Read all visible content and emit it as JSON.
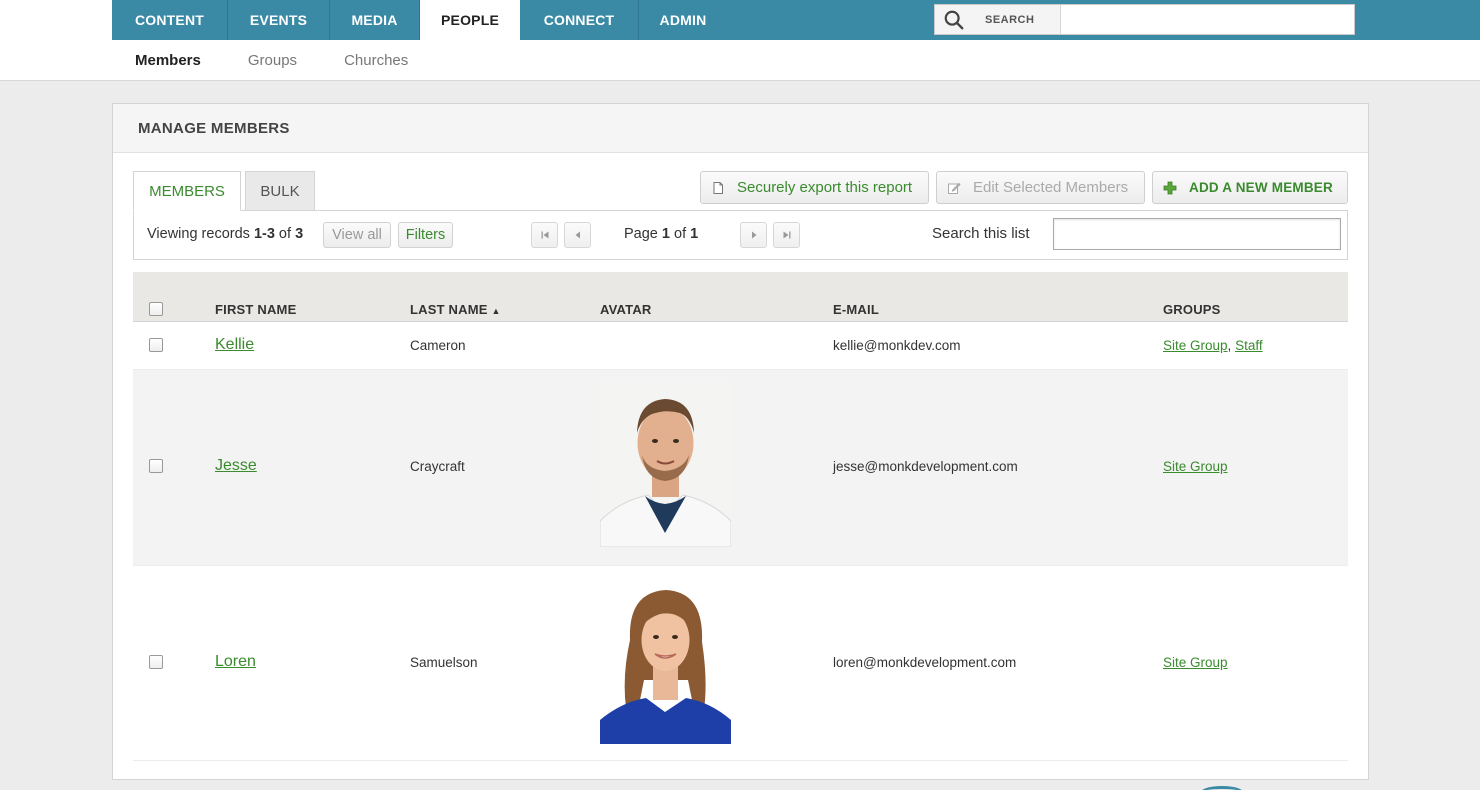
{
  "topnav": {
    "items": [
      {
        "label": "CONTENT",
        "active": false
      },
      {
        "label": "EVENTS",
        "active": false
      },
      {
        "label": "MEDIA",
        "active": false
      },
      {
        "label": "PEOPLE",
        "active": true
      },
      {
        "label": "CONNECT",
        "active": false
      },
      {
        "label": "ADMIN",
        "active": false
      }
    ],
    "search_label": "SEARCH",
    "search_value": ""
  },
  "subnav": {
    "items": [
      {
        "label": "Members",
        "active": true
      },
      {
        "label": "Groups",
        "active": false
      },
      {
        "label": "Churches",
        "active": false
      }
    ]
  },
  "panel": {
    "title": "MANAGE MEMBERS",
    "tabs": [
      {
        "label": "MEMBERS",
        "active": true
      },
      {
        "label": "BULK",
        "active": false
      }
    ],
    "actions": {
      "export_label": "Securely export this report",
      "edit_label": "Edit Selected Members",
      "add_label": "ADD A NEW MEMBER"
    },
    "toolbar": {
      "viewing_prefix": "Viewing records ",
      "viewing_range": "1-3",
      "viewing_of": " of ",
      "viewing_total": "3",
      "view_all_label": "View all",
      "filters_label": "Filters",
      "page_prefix": "Page ",
      "page_current": "1",
      "page_of": " of ",
      "page_total": "1",
      "search_list_label": "Search this list",
      "search_list_value": ""
    },
    "table": {
      "headers": {
        "first_name": "FIRST NAME",
        "last_name": "LAST NAME",
        "sort_indicator": "▲",
        "avatar": "AVATAR",
        "email": "E-MAIL",
        "groups": "GROUPS"
      },
      "rows": [
        {
          "first": "Kellie",
          "last": "Cameron",
          "email": "kellie@monkdev.com",
          "groups": [
            "Site Group",
            "Staff"
          ],
          "group_separator": ", ",
          "has_avatar": false
        },
        {
          "first": "Jesse",
          "last": "Craycraft",
          "email": "jesse@monkdevelopment.com",
          "groups": [
            "Site Group"
          ],
          "has_avatar": true
        },
        {
          "first": "Loren",
          "last": "Samuelson",
          "email": "loren@monkdevelopment.com",
          "groups": [
            "Site Group"
          ],
          "has_avatar": true
        }
      ]
    }
  },
  "colors": {
    "nav_bg": "#3a8aa6",
    "accent_green": "#3a8a2e"
  }
}
